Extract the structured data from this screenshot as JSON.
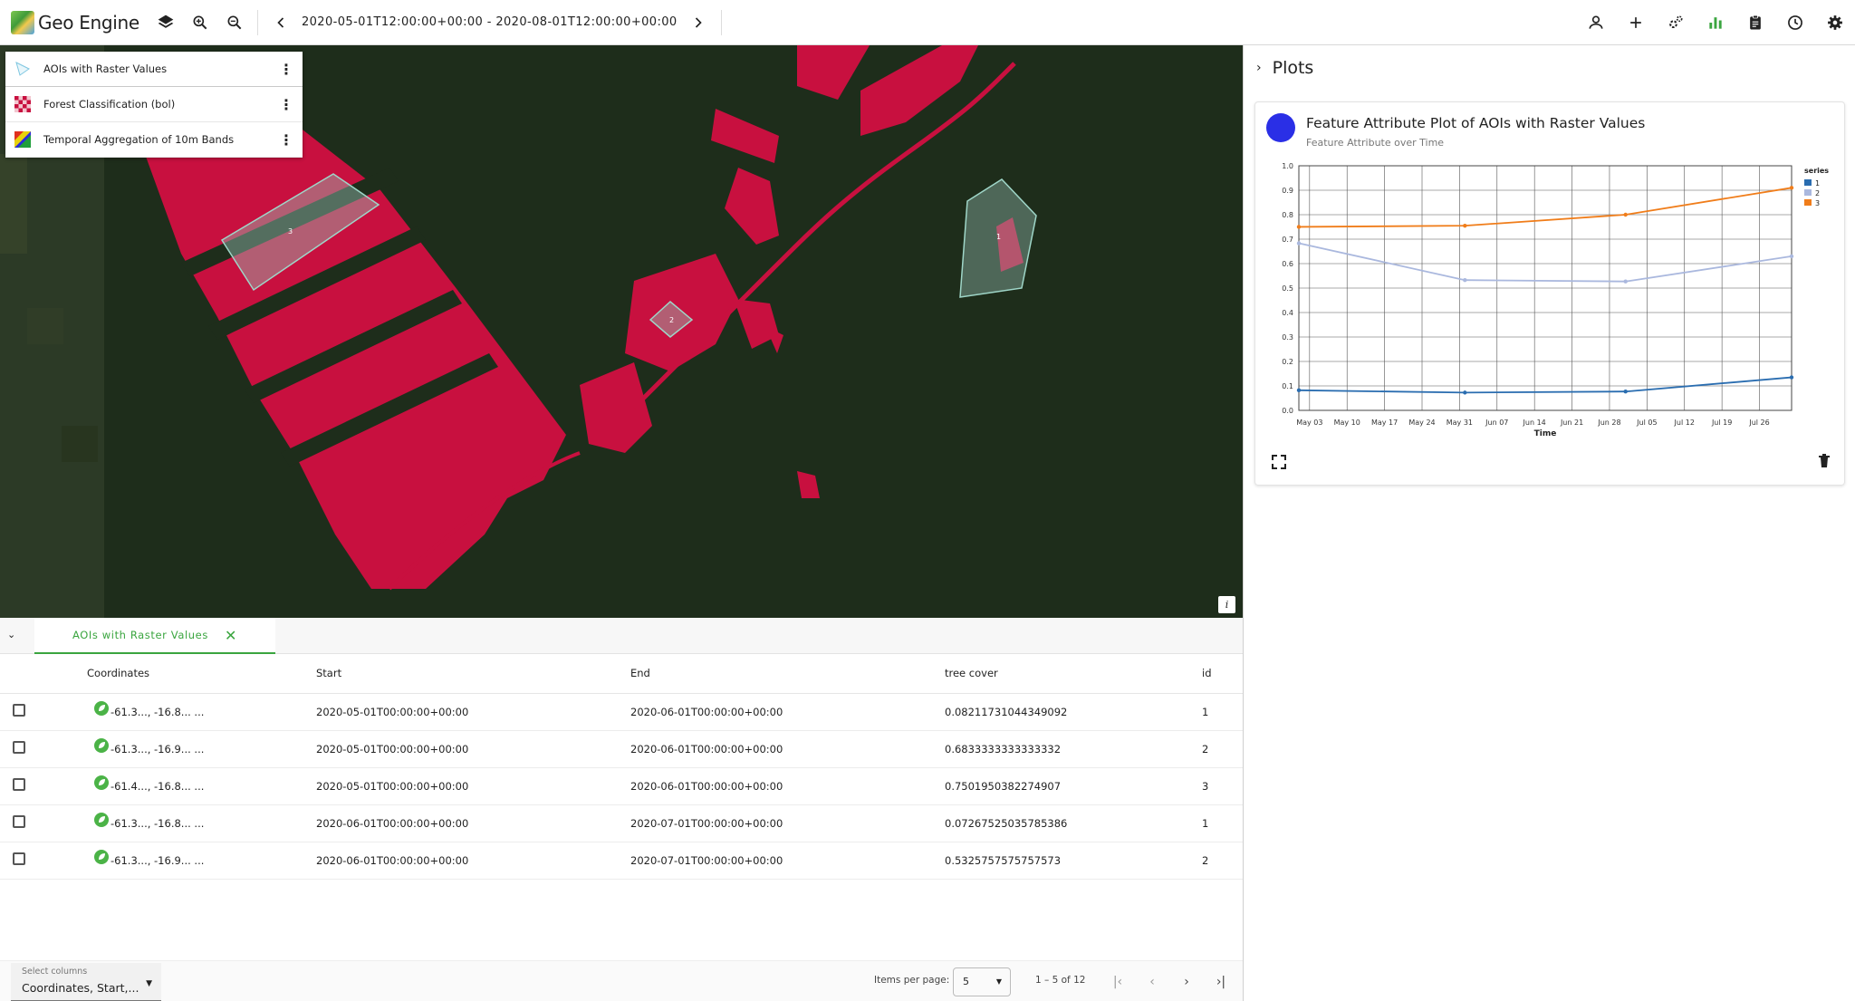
{
  "app": {
    "name": "Geo Engine"
  },
  "toolbar": {
    "time_range": "2020-05-01T12:00:00+00:00 - 2020-08-01T12:00:00+00:00",
    "left_icons": [
      "layers-icon",
      "zoom-in-icon",
      "zoom-out-icon"
    ],
    "right_icons": [
      "account-icon",
      "add-icon",
      "operators-icon",
      "plots-icon",
      "clipboard-icon",
      "clock-icon",
      "settings-icon"
    ]
  },
  "layers": [
    {
      "name": "AOIs with Raster Values",
      "icon": "vector-layer-icon"
    },
    {
      "name": "Forest Classification (bol)",
      "icon": "checker-raster-icon"
    },
    {
      "name": "Temporal Aggregation of 10m Bands",
      "icon": "rainbow-raster-icon"
    }
  ],
  "map": {
    "polygon_labels": [
      "3",
      "2",
      "1"
    ],
    "info_label": "i"
  },
  "plots_panel": {
    "title": "Plots",
    "card": {
      "title": "Feature Attribute Plot of AOIs with Raster Values",
      "subtitle": "Feature Attribute over Time",
      "avatar_color": "#2a2fe6"
    }
  },
  "chart_data": {
    "type": "line",
    "xlabel": "Time",
    "ylabel": "",
    "x_ticks": [
      "May 03",
      "May 10",
      "May 17",
      "May 24",
      "May 31",
      "Jun 07",
      "Jun 14",
      "Jun 21",
      "Jun 28",
      "Jul 05",
      "Jul 12",
      "Jul 19",
      "Jul 26"
    ],
    "y_ticks": [
      "0.0",
      "0.1",
      "0.2",
      "0.3",
      "0.4",
      "0.5",
      "0.6",
      "0.7",
      "0.8",
      "0.9",
      "1.0"
    ],
    "ylim": [
      0,
      1
    ],
    "x_dates": [
      "2020-05-01",
      "2020-06-01",
      "2020-07-01",
      "2020-08-01"
    ],
    "legend_title": "series",
    "legend_placement": "top-right",
    "grid": true,
    "series": [
      {
        "name": "1",
        "color": "#2a6db0",
        "values": [
          0.0821,
          0.0727,
          0.077,
          0.135
        ]
      },
      {
        "name": "2",
        "color": "#aab8de",
        "values": [
          0.6833,
          0.5326,
          0.527,
          0.63
        ]
      },
      {
        "name": "3",
        "color": "#f07d1a",
        "values": [
          0.7502,
          0.755,
          0.8,
          0.91
        ]
      }
    ]
  },
  "table": {
    "tab_label": "AOIs with Raster Values",
    "columns": [
      "Coordinates",
      "Start",
      "End",
      "tree cover",
      "id"
    ],
    "rows": [
      {
        "coords": "-61.3..., -16.8... ...",
        "start": "2020-05-01T00:00:00+00:00",
        "end": "2020-06-01T00:00:00+00:00",
        "tree_cover": "0.08211731044349092",
        "id": "1"
      },
      {
        "coords": "-61.3..., -16.9... ...",
        "start": "2020-05-01T00:00:00+00:00",
        "end": "2020-06-01T00:00:00+00:00",
        "tree_cover": "0.6833333333333332",
        "id": "2"
      },
      {
        "coords": "-61.4..., -16.8... ...",
        "start": "2020-05-01T00:00:00+00:00",
        "end": "2020-06-01T00:00:00+00:00",
        "tree_cover": "0.7501950382274907",
        "id": "3"
      },
      {
        "coords": "-61.3..., -16.8... ...",
        "start": "2020-06-01T00:00:00+00:00",
        "end": "2020-07-01T00:00:00+00:00",
        "tree_cover": "0.07267525035785386",
        "id": "1"
      },
      {
        "coords": "-61.3..., -16.9... ...",
        "start": "2020-06-01T00:00:00+00:00",
        "end": "2020-07-01T00:00:00+00:00",
        "tree_cover": "0.5325757575757573",
        "id": "2"
      }
    ],
    "select_columns_label": "Select columns",
    "select_columns_value": "Coordinates, Start,...",
    "items_per_page_label": "Items per page:",
    "items_per_page": "5",
    "range_label": "1 – 5 of 12"
  }
}
